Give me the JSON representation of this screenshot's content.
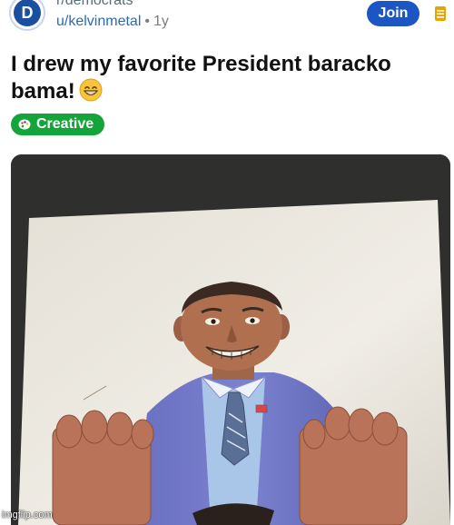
{
  "post": {
    "subreddit": "r/democrats",
    "subreddit_icon": "D",
    "username": "u/kelvinmetal",
    "separator": "•",
    "age": "1y",
    "join_label": "Join",
    "title": "I drew my favorite President baracko bama!",
    "title_emoji": "grinning-face-emoji",
    "flair_label": "Creative",
    "flair_icon": "palette-icon"
  },
  "media": {
    "description_icon": "drawing-photo"
  },
  "watermark": "imgflip.com",
  "colors": {
    "join_button": "#1c56c4",
    "flair": "#14a53a",
    "username": "#2a6bb4"
  }
}
